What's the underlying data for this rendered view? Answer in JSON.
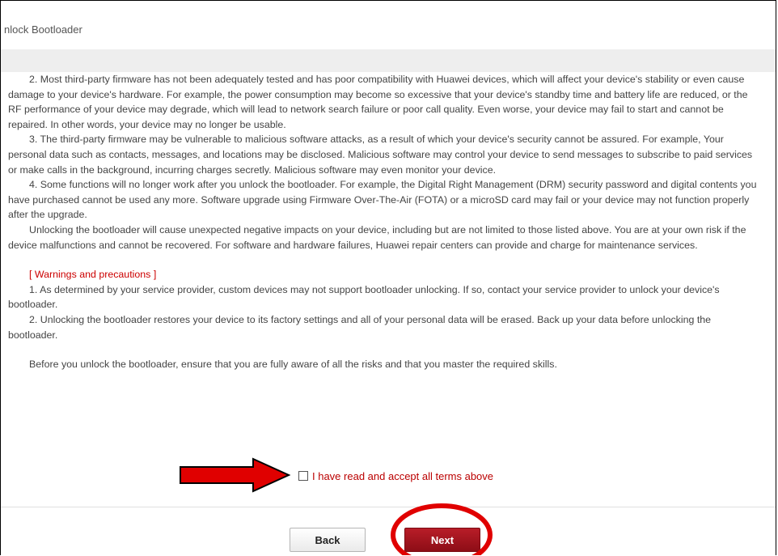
{
  "window": {
    "title": "nlock Bootloader"
  },
  "terms": {
    "p2": "2. Most third-party firmware has not been adequately tested and has poor compatibility with Huawei devices, which will affect your device's stability or even cause damage to your device's hardware. For example, the power consumption may become so excessive that your device's standby time and battery life are reduced, or the RF performance of your device may degrade, which will lead to network search failure or poor call quality. Even worse, your device may fail to start and cannot be repaired. In other words, your device may no longer be usable.",
    "p3": "3. The third-party firmware may be vulnerable to malicious software attacks, as a result of which your device's security cannot be assured. For example, Your personal data such as contacts, messages, and locations may be disclosed. Malicious software may control your device to send messages to subscribe to paid services or make calls in the background, incurring charges secretly. Malicious software may even monitor your device.",
    "p4": "4. Some functions will no longer work after you unlock the bootloader. For example, the Digital Right Management (DRM) security password and digital contents you have purchased cannot be used any more. Software upgrade using Firmware Over-The-Air (FOTA) or a microSD card may fail or your device may not function properly after the upgrade.",
    "p5": "Unlocking the bootloader will cause unexpected negative impacts on your device, including but are not limited to those listed above. You are at your own risk if the device malfunctions and cannot be recovered. For software and hardware failures, Huawei repair centers can provide and charge for maintenance services."
  },
  "warnings": {
    "heading": "[ Warnings and precautions ]",
    "w1": "1. As determined by your service provider, custom devices may not support bootloader unlocking. If so, contact your service provider to unlock your device's bootloader.",
    "w2": "2. Unlocking the bootloader restores your device to its factory settings and all of your personal data will be erased. Back up your data before unlocking the bootloader.",
    "final": "Before you unlock the bootloader, ensure that you are fully aware of all the risks and that you master the required skills."
  },
  "accept": {
    "label": "I have read and accept all terms above",
    "checked": false
  },
  "buttons": {
    "back": "Back",
    "next": "Next"
  },
  "colors": {
    "accent": "#c00000",
    "next_button": "#a01520",
    "annotation": "#e00000"
  }
}
